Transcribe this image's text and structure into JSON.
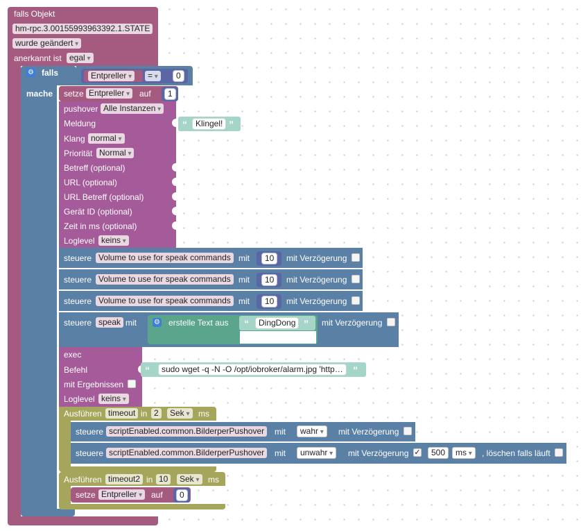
{
  "on_block": {
    "title": "falls Objekt",
    "object_id": "hm-rpc.3.00155993963392.1.STATE",
    "trigger": "wurde geändert",
    "ack_label": "anerkannt ist",
    "ack_value": "egal"
  },
  "if_block": {
    "if_label": "falls",
    "do_label": "mache",
    "condition": {
      "variable": "Entpreller",
      "operator": "=",
      "value": "0"
    }
  },
  "set_var": {
    "setze": "setze",
    "variable": "Entpreller",
    "auf": "auf",
    "value": "1"
  },
  "pushover": {
    "label": "pushover",
    "instance": "Alle Instanzen",
    "meldung_label": "Meldung",
    "meldung_value": "Klingel!",
    "klang_label": "Klang",
    "klang_value": "normal",
    "prio_label": "Priorität",
    "prio_value": "Normal",
    "betreff": "Betreff (optional)",
    "url": "URL (optional)",
    "url_betreff": "URL Betreff (optional)",
    "geraet": "Gerät ID (optional)",
    "zeit": "Zeit in ms (optional)",
    "loglevel_label": "Loglevel",
    "loglevel_value": "keins"
  },
  "control": {
    "steuere": "steuere",
    "mit": "mit",
    "delay_label": "mit Verzögerung",
    "rows": [
      {
        "target": "Volume to use for speak commands",
        "value": "10"
      },
      {
        "target": "Volume to use for speak commands",
        "value": "10"
      },
      {
        "target": "Volume to use for speak commands",
        "value": "10"
      }
    ],
    "speak_target": "speak",
    "text_label": "erstelle Text aus",
    "text_value": "DingDong"
  },
  "exec": {
    "label": "exec",
    "befehl_label": "Befehl",
    "command": "sudo wget -q -N -O /opt/iobroker/alarm.jpg 'http…",
    "results_label": "mit Ergebnissen",
    "loglevel_label": "Loglevel",
    "loglevel_value": "keins"
  },
  "timeout1": {
    "label": "Ausführen",
    "name": "timeout",
    "in": "in",
    "value": "2",
    "unit": "Sek",
    "ms": "ms",
    "row1": {
      "target": "scriptEnabled.common.BilderperPushover",
      "value": "wahr"
    },
    "row2": {
      "target": "scriptEnabled.common.BilderperPushover",
      "value": "unwahr",
      "delay_checked": "✓",
      "delay_value": "500",
      "delay_unit": "ms",
      "clear_label": ", löschen falls läuft"
    }
  },
  "timeout2": {
    "label": "Ausführen",
    "name": "timeout2",
    "in": "in",
    "value": "10",
    "unit": "Sek",
    "ms": "ms",
    "set": {
      "setze": "setze",
      "variable": "Entpreller",
      "auf": "auf",
      "value": "0"
    }
  },
  "colors": {
    "event": "#a55b80",
    "logic": "#5b80a5",
    "action": "#a55b99",
    "text": "#5ba58c",
    "timeout": "#a5a55b",
    "math": "#5b67a5"
  }
}
